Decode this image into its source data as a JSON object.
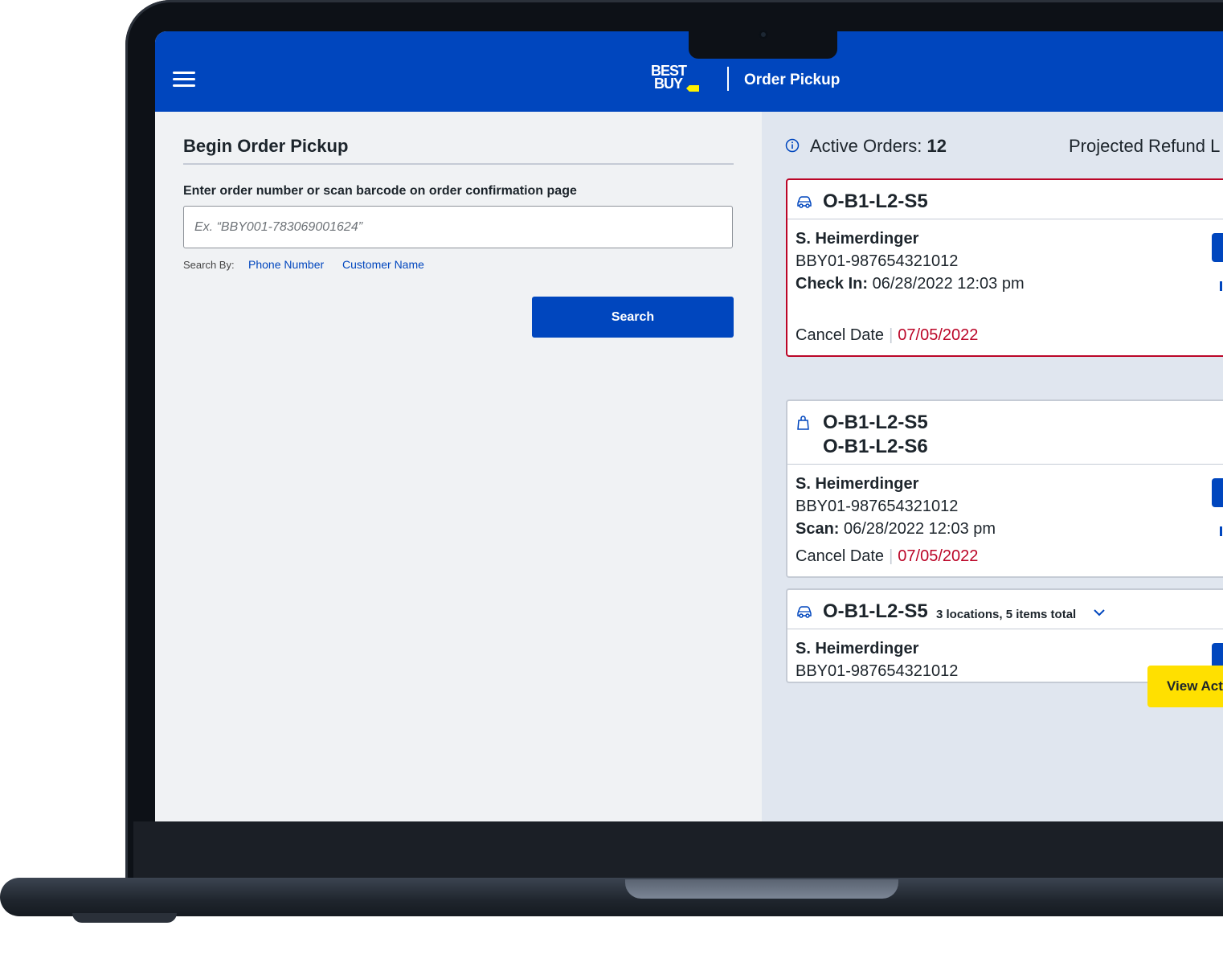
{
  "header": {
    "logo_text_line1": "BEST",
    "logo_text_line2": "BUY",
    "title": "Order Pickup",
    "brand_color": "#0046be",
    "logo_tag_color": "#fff200"
  },
  "left": {
    "page_title": "Begin Order Pickup",
    "field_label": "Enter order number or scan barcode on order confirmation page",
    "input_placeholder": "Ex. “BBY001-783069001624”",
    "input_value": "",
    "search_by_label": "Search By:",
    "search_by_links": [
      "Phone Number",
      "Customer Name"
    ],
    "search_button": "Search"
  },
  "right": {
    "active_orders_label": "Active Orders:",
    "active_orders_count": "12",
    "refund_label": "Projected Refund L",
    "orders": [
      {
        "icon": "car-icon",
        "ids": [
          "O-B1-L2-S5"
        ],
        "customer": "S. Heimerdinger",
        "order_number": "BBY01-987654321012",
        "event_label": "Check In:",
        "event_time": "06/28/2022 12:03 pm",
        "cancel_label": "Cancel Date",
        "cancel_date": "07/05/2022",
        "highlighted": true
      },
      {
        "icon": "shopping-bag-icon",
        "ids": [
          "O-B1-L2-S5",
          "O-B1-L2-S6"
        ],
        "customer": "S. Heimerdinger",
        "order_number": "BBY01-987654321012",
        "event_label": "Scan:",
        "event_time": "06/28/2022 12:03 pm",
        "cancel_label": "Cancel Date",
        "cancel_date": "07/05/2022",
        "highlighted": false
      },
      {
        "icon": "car-icon",
        "ids": [
          "O-B1-L2-S5"
        ],
        "summary": "3 locations, 5 items total",
        "customer": "S. Heimerdinger",
        "order_number": "BBY01-987654321012",
        "highlighted": false
      }
    ],
    "view_button": "View Act",
    "alert_color": "#bb0628",
    "view_button_color": "#ffe000"
  }
}
